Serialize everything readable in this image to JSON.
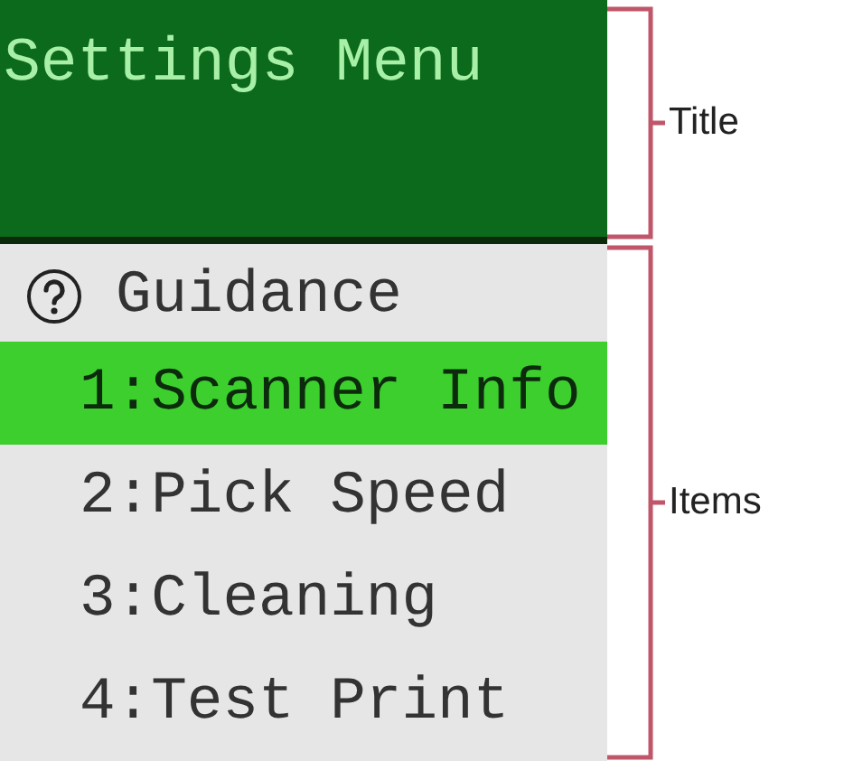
{
  "screen": {
    "title": "Settings Menu",
    "items": [
      {
        "kind": "help",
        "label": "Guidance",
        "selected": false
      },
      {
        "kind": "option",
        "label": "1:Scanner Info",
        "selected": true
      },
      {
        "kind": "option",
        "label": "2:Pick Speed",
        "selected": false
      },
      {
        "kind": "option",
        "label": "3:Cleaning",
        "selected": false
      },
      {
        "kind": "option",
        "label": "4:Test Print",
        "selected": false
      }
    ]
  },
  "annotations": [
    {
      "label": "Title"
    },
    {
      "label": "Items"
    }
  ]
}
